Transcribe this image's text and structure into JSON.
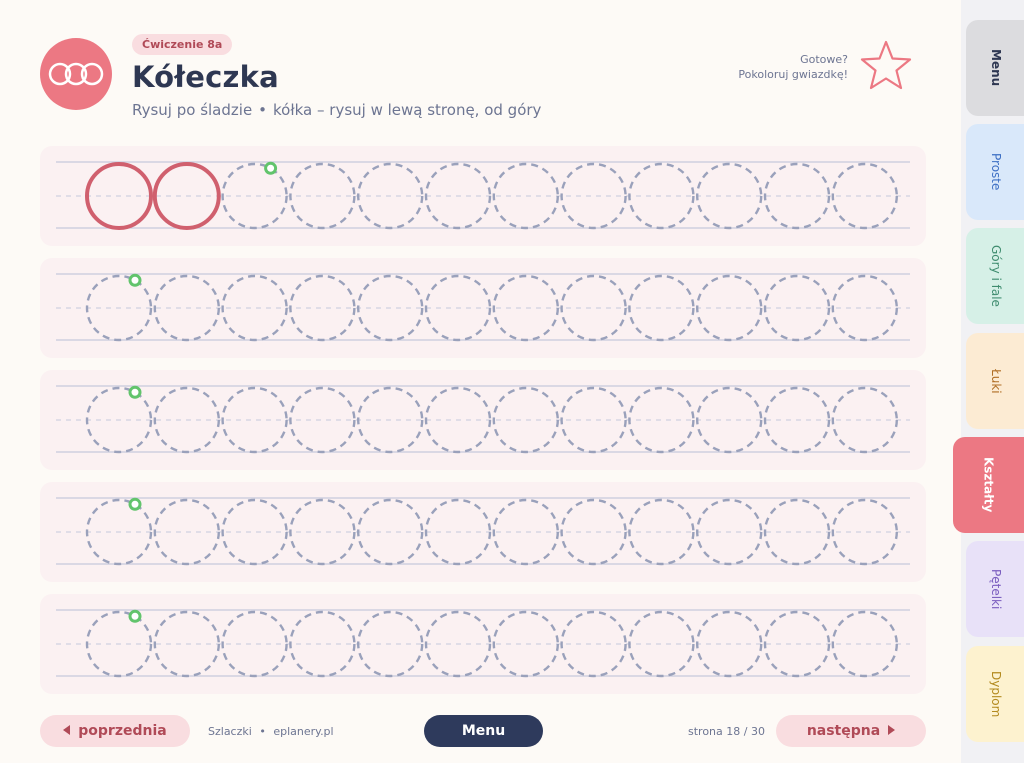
{
  "header": {
    "exercise_badge": "Ćwiczenie 8a",
    "title": "Kółeczka",
    "subtitle_part1": "Rysuj po śladzie",
    "subtitle_separator": "•",
    "subtitle_part2": "kółka – rysuj w lewą stronę, od góry",
    "ready_line1": "Gotowe?",
    "ready_line2": "Pokoloruj gwiazdkę!",
    "logo_icon": "three-circles-icon",
    "star_icon": "star-outline-icon"
  },
  "worksheet": {
    "rows": 5,
    "circles_per_row": 12,
    "example_solid_circles_row1": 2,
    "start_marker": "green-start-dot",
    "colors": {
      "guide_line": "#c6c9dc",
      "dashed_circle": "#9aa1bb",
      "solid_circle": "#d0606e",
      "start_dot": "#62c46c",
      "row_background": "#fbf1f2"
    }
  },
  "footer": {
    "prev_label": "poprzednia",
    "site_name": "Szlaczki",
    "site_separator": "•",
    "site_url": "eplanery.pl",
    "menu_label": "Menu",
    "page_label": "strona 18 / 30",
    "next_label": "następna"
  },
  "sidebar": {
    "tabs": [
      {
        "label": "Menu",
        "active": false,
        "color": "#dcdcdf"
      },
      {
        "label": "Proste",
        "active": false,
        "color": "#d9e8fa"
      },
      {
        "label": "Góry i fale",
        "active": false,
        "color": "#d6f0e7"
      },
      {
        "label": "Łuki",
        "active": false,
        "color": "#fcebd3"
      },
      {
        "label": "Kształty",
        "active": true,
        "color": "#ec7883"
      },
      {
        "label": "Pętelki",
        "active": false,
        "color": "#e8e1f8"
      },
      {
        "label": "Dyplom",
        "active": false,
        "color": "#fdf2cf"
      }
    ]
  },
  "colors": {
    "accent": "#ec7883",
    "dark": "#2e3a5c",
    "background": "#fdfaf6"
  }
}
